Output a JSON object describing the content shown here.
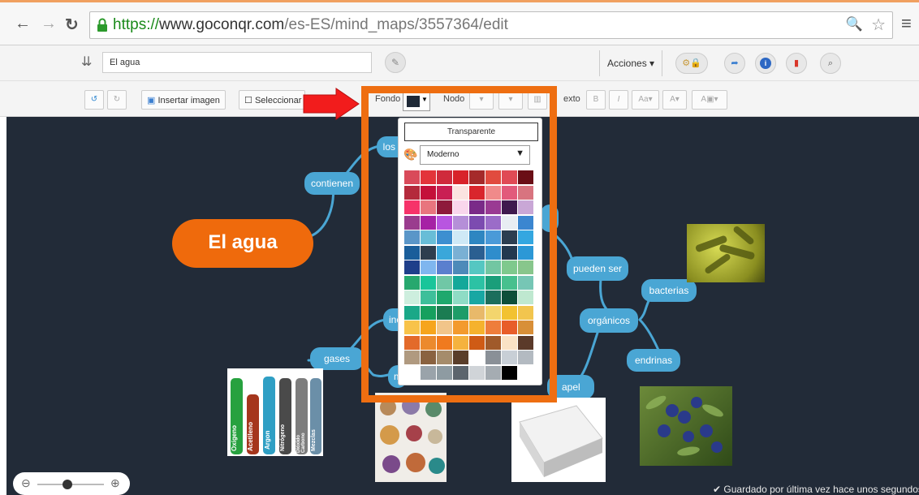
{
  "browser": {
    "url_scheme": "https://",
    "url_host": "www.goconqr.com",
    "url_path": "/es-ES/mind_maps/3557364/edit",
    "back_icon": "arrow-left-icon",
    "forward_icon": "arrow-right-icon",
    "reload_icon": "reload-icon"
  },
  "toolbar1": {
    "title_value": "El agua",
    "actions_label": "Acciones ▾"
  },
  "toolbar2": {
    "insert_image_label": "Insertar imagen",
    "select_label": "Seleccionar t",
    "fondo_label": "Fondo",
    "nodo_label": "Nodo",
    "texto_label": "exto"
  },
  "map": {
    "main_node": "El agua",
    "nodes": {
      "contienen": "contienen",
      "los": "los c",
      "ino": "ino",
      "gases": "gases",
      "m": "m",
      "pueden_ser": "pueden ser",
      "organicos": "orgánicos",
      "bacterias": "bacterias",
      "endrinas": "endrinas",
      "papel": "apel"
    },
    "gas_labels": [
      "Oxígeno",
      "Acetileno",
      "Argon",
      "Nitrógeno",
      "Dióxido Carbono",
      "Mezclas"
    ]
  },
  "popup": {
    "transparent_label": "Transparente",
    "theme_value": "Moderno"
  },
  "palette": [
    [
      "#d94a5a",
      "#e3343a",
      "#cf2a3c",
      "#d8232a",
      "#a52a2a",
      "#e14b3f",
      "#e04a55",
      "#6a0e16"
    ],
    [
      "#b42a3c",
      "#c4103a",
      "#c91f53",
      "#fbe3e0",
      "#d9262d",
      "#f08a8a",
      "#e25a7b",
      "#d8747f"
    ],
    [
      "#f6336a",
      "#e8757e",
      "#8e1a3b",
      "#f9d6ec",
      "#7a2a88",
      "#9a3a93",
      "#3f1a4e",
      "#c9a7d6"
    ],
    [
      "#9a3c8e",
      "#a622a5",
      "#b855e0",
      "#b58fd8",
      "#7c4bb0",
      "#9b6cc8",
      "#e8edf3",
      "#3b86d0"
    ],
    [
      "#5a96c8",
      "#68bdd7",
      "#3d8fd0",
      "#cfe9f6",
      "#2e86c1",
      "#4a9ad8",
      "#2c3e50",
      "#34a7e0"
    ],
    [
      "#1a5e9a",
      "#2e3e4e",
      "#3aa7da",
      "#7ab0d4",
      "#2b5f91",
      "#2f8dcc",
      "#23394f",
      "#2c98d6"
    ],
    [
      "#1f3f8a",
      "#7fb6ef",
      "#5b7fce",
      "#4d8ab9",
      "#55c7c2",
      "#72c6a2",
      "#7fc98d",
      "#88c68c"
    ],
    [
      "#27a86e",
      "#19c59a",
      "#70c7a6",
      "#14a89a",
      "#2cc2a4",
      "#1a9e7a",
      "#47c08e",
      "#76c6b5"
    ],
    [
      "#cdeede",
      "#3ebf9a",
      "#1fa86d",
      "#8fdcc5",
      "#18a7a3",
      "#1b6e5c",
      "#0e4f3a",
      "#bfe8d0"
    ],
    [
      "#1aa888",
      "#16a05e",
      "#1b7c52",
      "#1e9c68",
      "#e8b96a",
      "#f3d56d",
      "#f2c231",
      "#f2c54e"
    ],
    [
      "#f8c34a",
      "#f6a51d",
      "#f1c58a",
      "#f39a2d",
      "#f5b22d",
      "#ee7d3b",
      "#e85d2a",
      "#d88f38"
    ],
    [
      "#e36a2a",
      "#ec8a2d",
      "#f07a1e",
      "#f5b23e",
      "#cf5b15",
      "#a05a2a",
      "#fae2c5",
      "#5b3a2a"
    ],
    [
      "#b09a80",
      "#8a6240",
      "#a58c6b",
      "#5a3e2a",
      "#ffffff",
      "#8a9097",
      "#c8cfd6",
      "#b3bac1"
    ],
    [
      "#ffffff",
      "#9aa3aa",
      "#8e9ba2",
      "#5c656d",
      "#d0d4d8",
      "#a5acb2",
      "#000000",
      "#ffffff"
    ]
  ],
  "zoom": {
    "out_icon": "zoom-out-icon",
    "in_icon": "zoom-in-icon",
    "level": 0.45
  },
  "status": {
    "saved_text": "✔ Guardado por última vez hace unos segundos"
  },
  "colors": {
    "canvas_bg": "#222b38",
    "node_blue": "#4aa6d4",
    "main_orange": "#ef6a0c",
    "highlight_orange": "#ee6e11",
    "arrow_red": "#f21c1c",
    "fondo_current": "#1f2937"
  }
}
